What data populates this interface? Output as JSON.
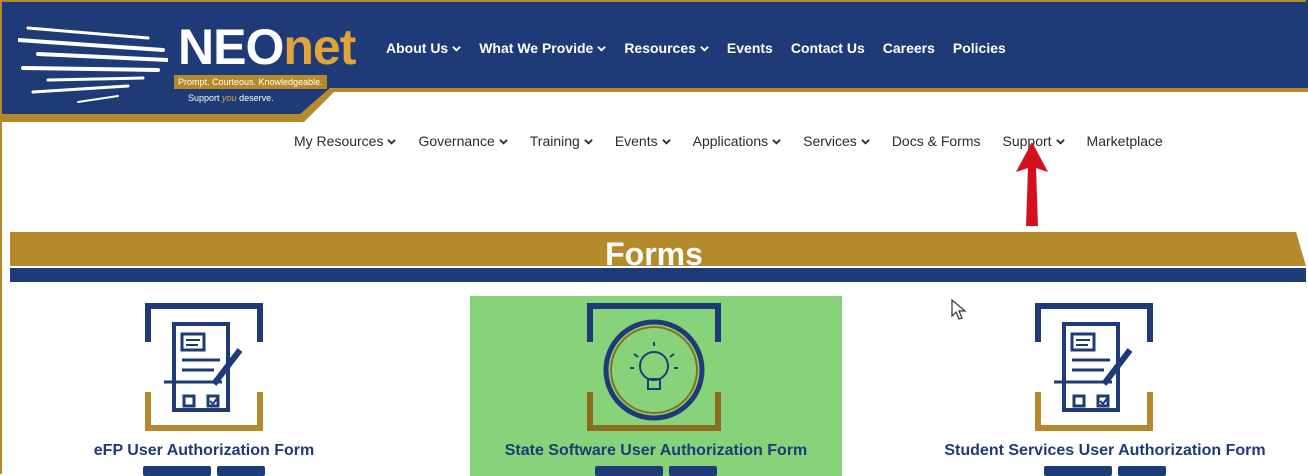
{
  "brand": {
    "name_left": "NEO",
    "name_right": "net",
    "tagline": "Prompt. Courteous. Knowledgeable.",
    "support_prefix": "Support",
    "support_you": "you",
    "support_suffix": "deserve."
  },
  "top_nav": [
    {
      "label": "About Us",
      "has_dropdown": true
    },
    {
      "label": "What We Provide",
      "has_dropdown": true
    },
    {
      "label": "Resources",
      "has_dropdown": true
    },
    {
      "label": "Events",
      "has_dropdown": false
    },
    {
      "label": "Contact Us",
      "has_dropdown": false
    },
    {
      "label": "Careers",
      "has_dropdown": false
    },
    {
      "label": "Policies",
      "has_dropdown": false
    }
  ],
  "sub_nav": [
    {
      "label": "My Resources",
      "has_dropdown": true
    },
    {
      "label": "Governance",
      "has_dropdown": true
    },
    {
      "label": "Training",
      "has_dropdown": true
    },
    {
      "label": "Events",
      "has_dropdown": true
    },
    {
      "label": "Applications",
      "has_dropdown": true
    },
    {
      "label": "Services",
      "has_dropdown": true
    },
    {
      "label": "Docs & Forms",
      "has_dropdown": false
    },
    {
      "label": "Support",
      "has_dropdown": true
    },
    {
      "label": "Marketplace",
      "has_dropdown": false
    }
  ],
  "banner": {
    "title": "Forms"
  },
  "cards": [
    {
      "title": "eFP User Authorization Form",
      "icon": "form-document-icon",
      "highlighted": false
    },
    {
      "title": "State Software User Authorization Form",
      "icon": "lightbulb-icon",
      "highlighted": true
    },
    {
      "title": "Student Services User Authorization Form",
      "icon": "form-document-icon",
      "highlighted": false
    }
  ],
  "colors": {
    "navy": "#1f3b77",
    "gold": "#b58a2b",
    "highlight_green": "#88d27a",
    "annotation_red": "#d4101e"
  }
}
